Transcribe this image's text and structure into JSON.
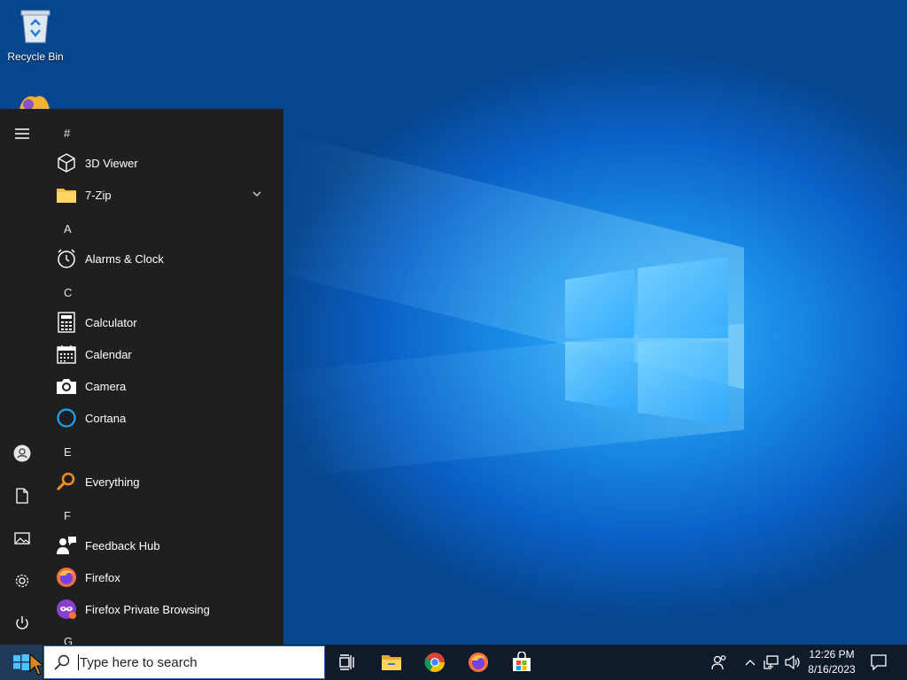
{
  "desktop": {
    "icons": [
      {
        "label": "Recycle Bin",
        "icon": "recycle-bin-icon"
      }
    ]
  },
  "start_menu": {
    "rail": [
      {
        "name": "hamburger-menu-icon"
      },
      {
        "name": "user-account-icon"
      },
      {
        "name": "documents-icon"
      },
      {
        "name": "pictures-icon"
      },
      {
        "name": "settings-gear-icon"
      },
      {
        "name": "power-icon"
      }
    ],
    "letters": [
      "#",
      "A",
      "C",
      "E",
      "F",
      "G"
    ],
    "apps": [
      {
        "label": "3D Viewer",
        "icon": "3d-viewer-icon"
      },
      {
        "label": "7-Zip",
        "icon": "folder-icon",
        "expandable": true
      },
      {
        "label": "Alarms & Clock",
        "icon": "alarm-clock-icon"
      },
      {
        "label": "Calculator",
        "icon": "calculator-icon"
      },
      {
        "label": "Calendar",
        "icon": "calendar-icon"
      },
      {
        "label": "Camera",
        "icon": "camera-icon"
      },
      {
        "label": "Cortana",
        "icon": "cortana-icon"
      },
      {
        "label": "Everything",
        "icon": "everything-search-icon"
      },
      {
        "label": "Feedback Hub",
        "icon": "feedback-hub-icon"
      },
      {
        "label": "Firefox",
        "icon": "firefox-icon"
      },
      {
        "label": "Firefox Private Browsing",
        "icon": "firefox-private-icon"
      }
    ]
  },
  "taskbar": {
    "search_placeholder": "Type here to search",
    "pinned": [
      "task-view-icon",
      "file-explorer-icon",
      "chrome-icon",
      "firefox-icon",
      "microsoft-store-icon"
    ],
    "tray": [
      "people-icon",
      "show-hidden-icons-chevron",
      "network-icon",
      "volume-icon"
    ],
    "time": "12:26 PM",
    "date": "8/16/2023",
    "notification_icon": "action-center-icon"
  },
  "colors": {
    "start_bg": "#1f1f1f",
    "taskbar_bg": "#0f1a2b",
    "accent": "#0078d7",
    "search_border": "#2d6fb3"
  }
}
